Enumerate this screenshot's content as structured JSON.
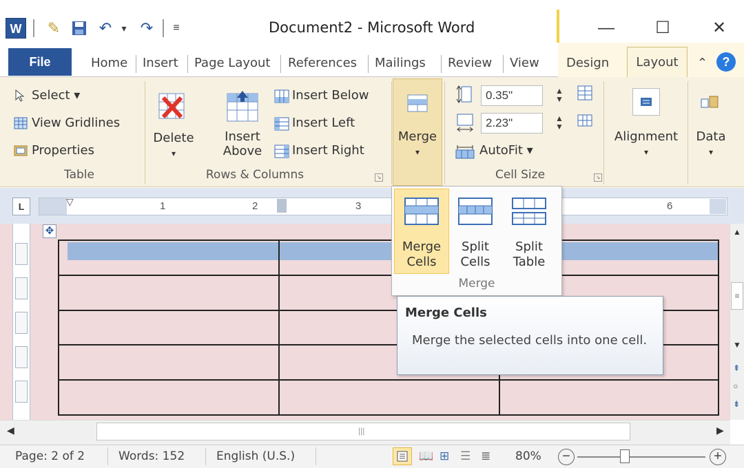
{
  "window": {
    "title": "Document2 - Microsoft Word",
    "app_icon_label": "W",
    "minimize_label": "—",
    "maximize_label": "☐",
    "close_label": "✕"
  },
  "tabs": {
    "file": "File",
    "items": [
      "Home",
      "Insert",
      "Page Layout",
      "References",
      "Mailings",
      "Review",
      "View"
    ],
    "design": "Design",
    "layout": "Layout"
  },
  "ribbon": {
    "table_group": {
      "select": "Select ▾",
      "view_gridlines": "View Gridlines",
      "properties": "Properties",
      "label": "Table"
    },
    "rows_columns_group": {
      "delete": "Delete",
      "delete_arrow": "▾",
      "insert_above_line1": "Insert",
      "insert_above_line2": "Above",
      "insert_below": "Insert Below",
      "insert_left": "Insert Left",
      "insert_right": "Insert Right",
      "label": "Rows & Columns"
    },
    "merge_group": {
      "merge": "Merge",
      "merge_arrow": "▾"
    },
    "cell_size_group": {
      "height_value": "0.35\"",
      "width_value": "2.23\"",
      "autofit": "AutoFit ▾",
      "label": "Cell Size"
    },
    "alignment": "Alignment",
    "alignment_arrow": "▾",
    "data": "Data",
    "data_arrow": "▾"
  },
  "ruler": {
    "numbers": [
      "1",
      "2",
      "3",
      "6"
    ],
    "tab_selector": "L"
  },
  "merge_dropdown": {
    "merge_cells_line1": "Merge",
    "merge_cells_line2": "Cells",
    "split_cells_line1": "Split",
    "split_cells_line2": "Cells",
    "split_table_line1": "Split",
    "split_table_line2": "Table",
    "group_label": "Merge"
  },
  "tooltip": {
    "title": "Merge Cells",
    "body": "Merge the selected cells into one cell."
  },
  "statusbar": {
    "page": "Page: 2 of 2",
    "words": "Words: 152",
    "language": "English (U.S.)",
    "zoom": "80%"
  },
  "colors": {
    "file_tab": "#2a5599",
    "ribbon_bg": "#f7f1e2",
    "document_bg": "#f0dadb",
    "selection": "#9bb8dc",
    "highlight": "#fde7a6"
  }
}
